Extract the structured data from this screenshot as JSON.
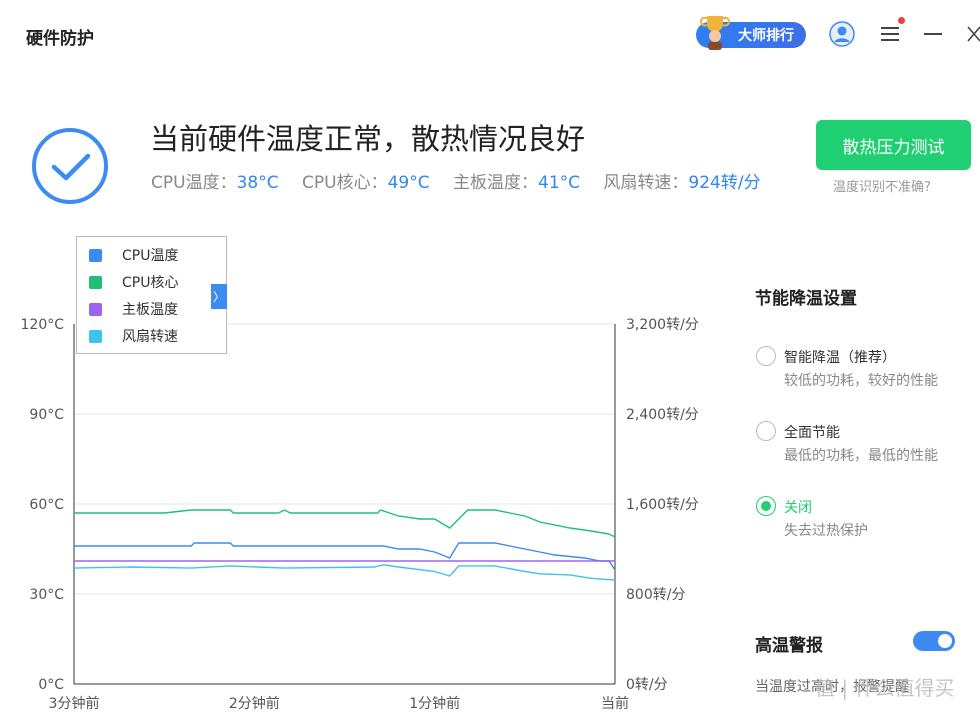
{
  "app": {
    "title": "硬件防护"
  },
  "header": {
    "rank_button": "大师排行"
  },
  "status": {
    "headline": "当前硬件温度正常，散热情况良好",
    "readouts": [
      {
        "label": "CPU温度：",
        "value": "38°C"
      },
      {
        "label": "CPU核心：",
        "value": "49°C"
      },
      {
        "label": "主板温度：",
        "value": "41°C"
      },
      {
        "label": "风扇转速：",
        "value": "924转/分"
      }
    ],
    "stress_button": "散热压力测试",
    "inaccurate_link": "温度识别不准确?"
  },
  "legend": {
    "toggle_glyph": "〉",
    "items": [
      {
        "label": "CPU温度",
        "color": "#3d8bf0"
      },
      {
        "label": "CPU核心",
        "color": "#1fbf7a"
      },
      {
        "label": "主板温度",
        "color": "#9b63f0"
      },
      {
        "label": "风扇转速",
        "color": "#3ec3ec"
      }
    ]
  },
  "chart_data": {
    "type": "line",
    "x_ticks": [
      "3分钟前",
      "2分钟前",
      "1分钟前",
      "当前"
    ],
    "x_range": [
      -180,
      0
    ],
    "y_left": {
      "ticks": [
        "0°C",
        "30°C",
        "60°C",
        "90°C",
        "120°C"
      ],
      "range": [
        0,
        120
      ]
    },
    "y_right": {
      "ticks": [
        "0转/分",
        "800转/分",
        "1,600转/分",
        "2,400转/分",
        "3,200转/分"
      ],
      "range": [
        0,
        3200
      ]
    },
    "grid": true,
    "series": [
      {
        "name": "CPU核心",
        "axis": "left",
        "color": "#1fbf7a",
        "points": [
          [
            -180,
            57
          ],
          [
            -150,
            57
          ],
          [
            -141,
            58
          ],
          [
            -128,
            58
          ],
          [
            -127,
            57
          ],
          [
            -112,
            57
          ],
          [
            -110,
            58
          ],
          [
            -108,
            57
          ],
          [
            -90,
            57
          ],
          [
            -79,
            57
          ],
          [
            -78,
            58
          ],
          [
            -75,
            57
          ],
          [
            -72,
            56
          ],
          [
            -65,
            55
          ],
          [
            -60,
            55
          ],
          [
            -55,
            52
          ],
          [
            -52,
            55
          ],
          [
            -49,
            58
          ],
          [
            -40,
            58
          ],
          [
            -35,
            57
          ],
          [
            -30,
            56
          ],
          [
            -25,
            54
          ],
          [
            -15,
            52
          ],
          [
            -8,
            51
          ],
          [
            -2,
            50
          ],
          [
            0,
            49
          ]
        ]
      },
      {
        "name": "CPU温度",
        "axis": "left",
        "color": "#3d8bf0",
        "points": [
          [
            -180,
            46
          ],
          [
            -141,
            46
          ],
          [
            -140,
            47
          ],
          [
            -128,
            47
          ],
          [
            -127,
            46
          ],
          [
            -80,
            46
          ],
          [
            -77,
            46
          ],
          [
            -72,
            45
          ],
          [
            -65,
            45
          ],
          [
            -60,
            44
          ],
          [
            -55,
            42
          ],
          [
            -52,
            47
          ],
          [
            -40,
            47
          ],
          [
            -35,
            46
          ],
          [
            -30,
            45
          ],
          [
            -25,
            44
          ],
          [
            -20,
            43
          ],
          [
            -10,
            42
          ],
          [
            -5,
            41
          ],
          [
            -2,
            41
          ],
          [
            0,
            38
          ]
        ]
      },
      {
        "name": "主板温度",
        "axis": "left",
        "color": "#9b63f0",
        "points": [
          [
            -180,
            41
          ],
          [
            0,
            41
          ]
        ]
      },
      {
        "name": "风扇转速",
        "axis": "right",
        "color": "#3ec3ec",
        "points": [
          [
            -180,
            1030
          ],
          [
            -160,
            1040
          ],
          [
            -141,
            1030
          ],
          [
            -128,
            1050
          ],
          [
            -110,
            1030
          ],
          [
            -80,
            1040
          ],
          [
            -77,
            1060
          ],
          [
            -72,
            1040
          ],
          [
            -60,
            1000
          ],
          [
            -55,
            960
          ],
          [
            -52,
            1050
          ],
          [
            -40,
            1050
          ],
          [
            -30,
            1000
          ],
          [
            -25,
            980
          ],
          [
            -15,
            970
          ],
          [
            -8,
            940
          ],
          [
            0,
            924
          ]
        ]
      }
    ]
  },
  "energy_panel": {
    "title": "节能降温设置",
    "options": [
      {
        "label": "智能降温（推荐）",
        "desc": "较低的功耗，较好的性能",
        "selected": false
      },
      {
        "label": "全面节能",
        "desc": "最低的功耗，最低的性能",
        "selected": false
      },
      {
        "label": "关闭",
        "desc": "失去过热保护",
        "selected": true
      }
    ]
  },
  "alert": {
    "title": "高温警报",
    "enabled": true,
    "desc": "当温度过高时，报警提醒"
  },
  "watermark": "值 | 什么值得买"
}
